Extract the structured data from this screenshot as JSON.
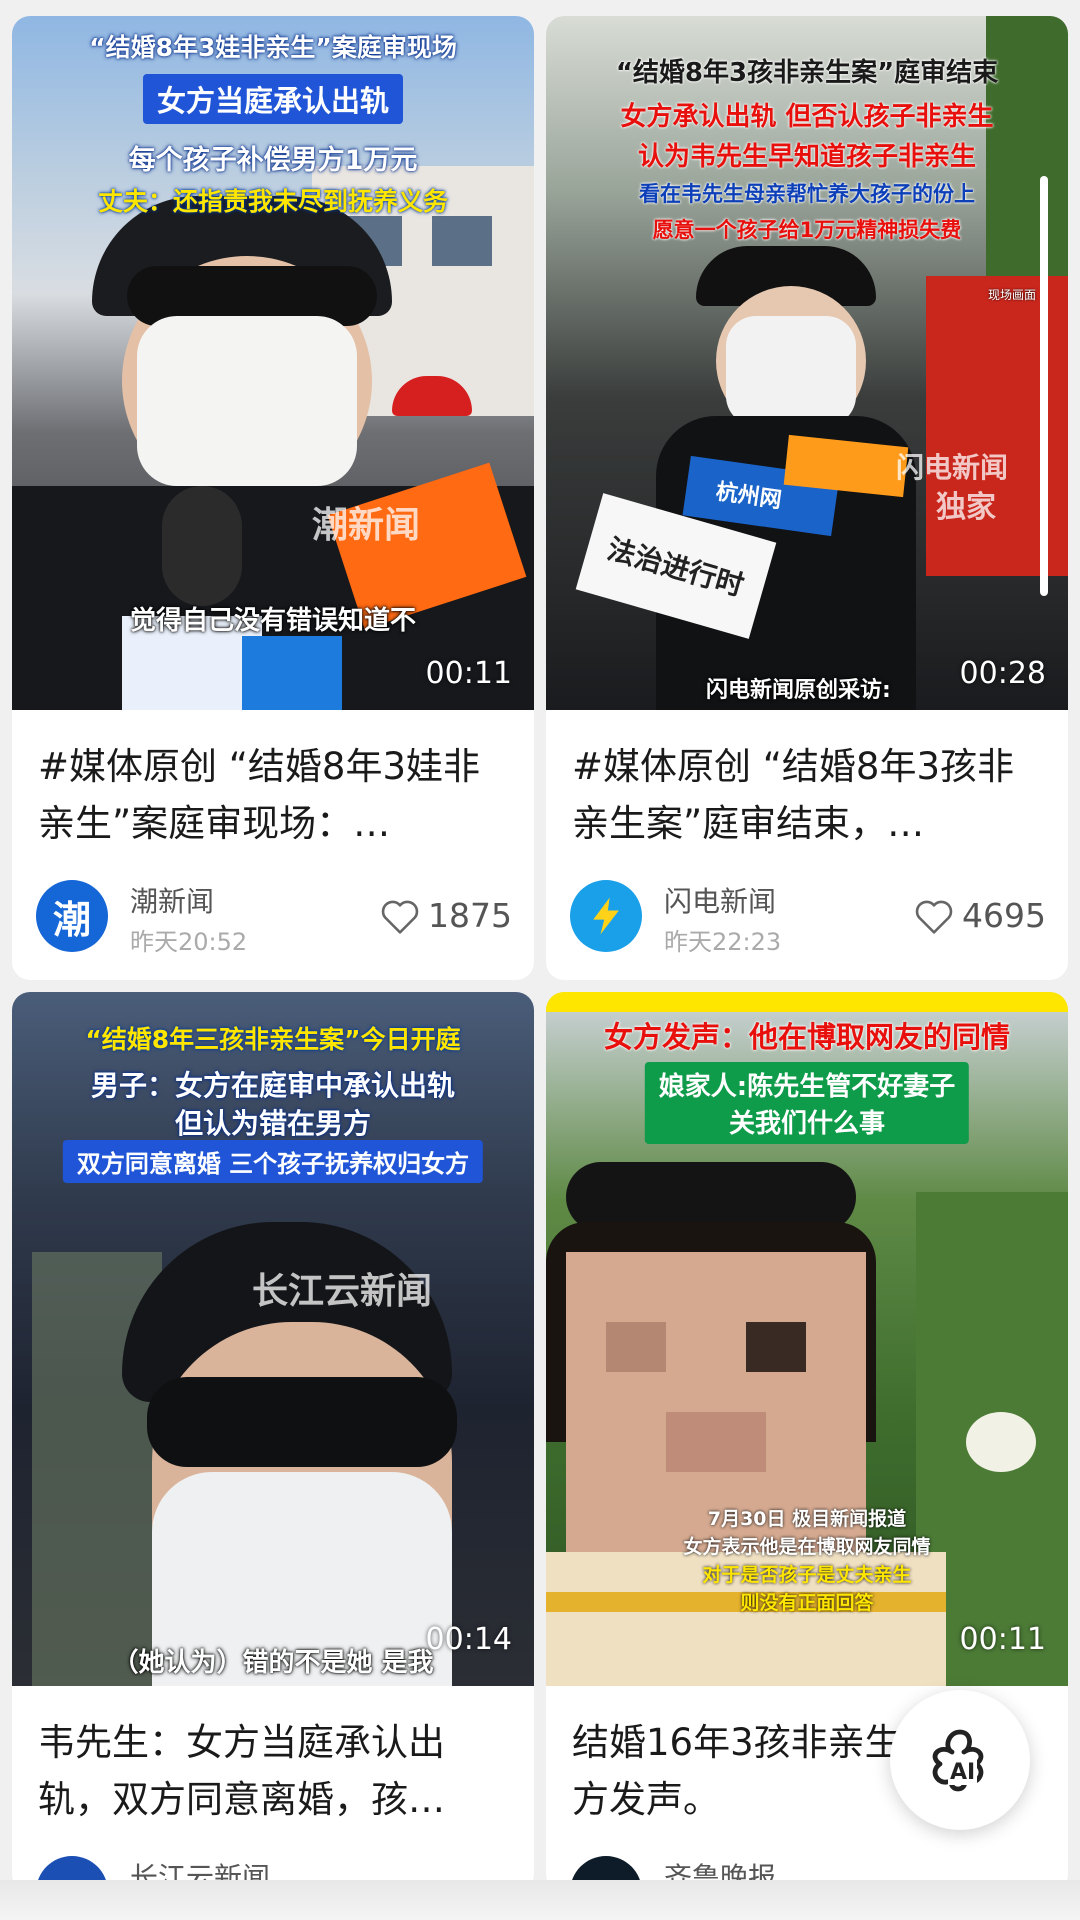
{
  "cards": [
    {
      "overlay": [
        "“结婚8年3娃非亲生”案庭审现场",
        "女方当庭承认出轨",
        "每个孩子补偿男方1万元",
        "丈夫：还指责我未尽到抚养义务"
      ],
      "watermark": "潮新闻",
      "subtitle": "觉得自己没有错误知道不",
      "duration": "00:11",
      "title": "#媒体原创 “结婚8年3娃非亲生”案庭审现场：…",
      "source": "潮新闻",
      "time": "昨天20:52",
      "likes": "1875"
    },
    {
      "overlay": [
        "“结婚8年3孩非亲生案”庭审结束",
        "女方承认出轨 但否认孩子非亲生",
        "认为韦先生早知道孩子非亲生",
        "看在韦先生母亲帮忙养大孩子的份上",
        "愿意一个孩子给1万元精神损失费"
      ],
      "tag": "现场画面",
      "watermark": "闪电新闻",
      "watermark2": "独家",
      "mic_label": "法治进行时",
      "mic_label2": "杭州网",
      "subtitle": "闪电新闻原创采访:",
      "duration": "00:28",
      "title": "#媒体原创 “结婚8年3孩非亲生案”庭审结束，…",
      "source": "闪电新闻",
      "time": "昨天22:23",
      "likes": "4695"
    },
    {
      "overlay": [
        "“结婚8年三孩非亲生案”今日开庭",
        "男子：女方在庭审中承认出轨",
        "但认为错在男方",
        "双方同意离婚 三个孩子抚养权归女方"
      ],
      "watermark": "长江云新闻",
      "subtitle": "（她认为）错的不是她 是我",
      "duration": "00:14",
      "title": "韦先生：女方当庭承认出轨，双方同意离婚，孩…",
      "source": "长江云新闻"
    },
    {
      "overlay": [
        "女方发声：他在博取网友的同情",
        "娘家人:陈先生管不好妻子",
        "关我们什么事"
      ],
      "caption": [
        "7月30日 极目新闻报道",
        "女方表示他是在博取网友同情",
        "对于是否孩子是丈夫亲生",
        "则没有正面回答"
      ],
      "duration": "00:11",
      "title": "结婚16年3孩非亲生方发声。",
      "source": "齐鲁晚报…"
    }
  ],
  "ai_button": {
    "label": "AI"
  },
  "colors": {
    "background": "#f0f0f0",
    "card": "#ffffff",
    "accent_red": "#e8100c",
    "accent_blue": "#0d3fb8"
  }
}
